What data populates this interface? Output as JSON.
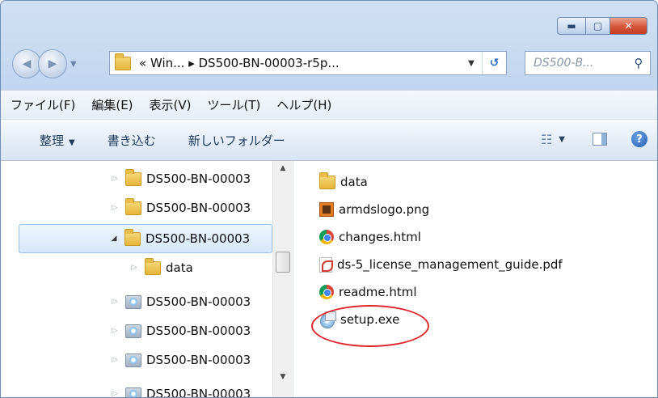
{
  "window": {
    "minimize_icon": "minimize-icon",
    "maximize_icon": "maximize-icon",
    "close_icon": "close-icon"
  },
  "nav": {
    "back_icon": "back-arrow-icon",
    "forward_icon": "forward-arrow-icon"
  },
  "address": {
    "path": "« Win... ▸ DS500-BN-00003-r5p...",
    "refresh_glyph": "↺"
  },
  "search": {
    "placeholder": "DS500-B...",
    "icon": "search-icon"
  },
  "menu": {
    "items": [
      "ファイル(F)",
      "編集(E)",
      "表示(V)",
      "ツール(T)",
      "ヘルプ(H)"
    ]
  },
  "toolbar": {
    "organize": "整理",
    "burn": "書き込む",
    "new_folder": "新しいフォルダー",
    "help_glyph": "?"
  },
  "tree": {
    "items": [
      {
        "label": "DS500-BN-00003",
        "icon": "folder-icon"
      },
      {
        "label": "DS500-BN-00003",
        "icon": "folder-icon"
      },
      {
        "label": "DS500-BN-00003",
        "icon": "folder-icon",
        "selected": true,
        "expanded": true
      },
      {
        "label": "data",
        "icon": "folder-icon"
      },
      {
        "label": "DS500-BN-00003",
        "icon": "disc-icon"
      },
      {
        "label": "DS500-BN-00003",
        "icon": "disc-icon"
      },
      {
        "label": "DS500-BN-00003",
        "icon": "disc-icon"
      },
      {
        "label": "DS500-BN-00003",
        "icon": "disc-icon"
      }
    ]
  },
  "files": {
    "items": [
      {
        "name": "data",
        "icon": "folder-icon"
      },
      {
        "name": "armdslogo.png",
        "icon": "png-icon"
      },
      {
        "name": "changes.html",
        "icon": "chrome-icon"
      },
      {
        "name": "ds-5_license_management_guide.pdf",
        "icon": "pdf-icon"
      },
      {
        "name": "readme.html",
        "icon": "chrome-icon"
      },
      {
        "name": "setup.exe",
        "icon": "exe-icon",
        "highlighted": true
      }
    ]
  },
  "colors": {
    "annotation": "#e0282e",
    "selection": "#d6e7fa"
  }
}
